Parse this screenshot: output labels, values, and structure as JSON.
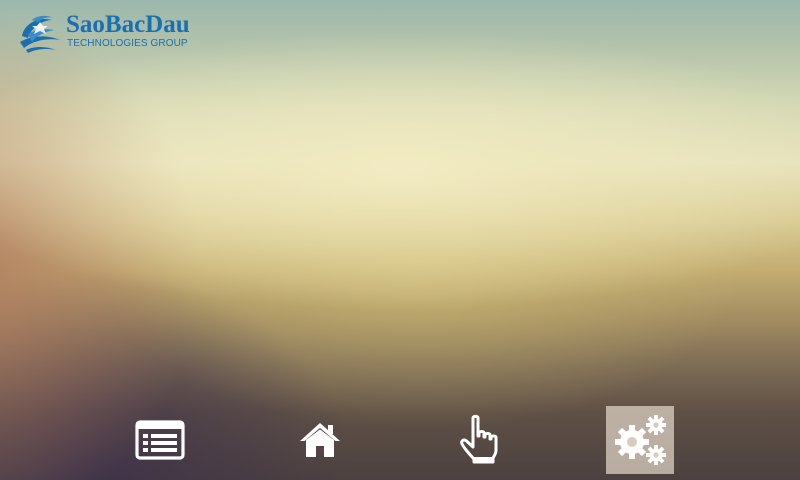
{
  "logo": {
    "name": "SaoBacDau",
    "subtitle": "TECHNOLOGIES GROUP",
    "icon": "saobacdau-logo-mark",
    "color": "#1a6fb0"
  },
  "nav": {
    "items": [
      {
        "id": "list",
        "icon": "list-icon",
        "active": false
      },
      {
        "id": "home",
        "icon": "home-icon",
        "active": false
      },
      {
        "id": "touch",
        "icon": "pointing-hand-icon",
        "active": false
      },
      {
        "id": "settings",
        "icon": "gears-icon",
        "active": true
      }
    ],
    "active_background": "#e2d6c8",
    "icon_color": "#ffffff"
  }
}
